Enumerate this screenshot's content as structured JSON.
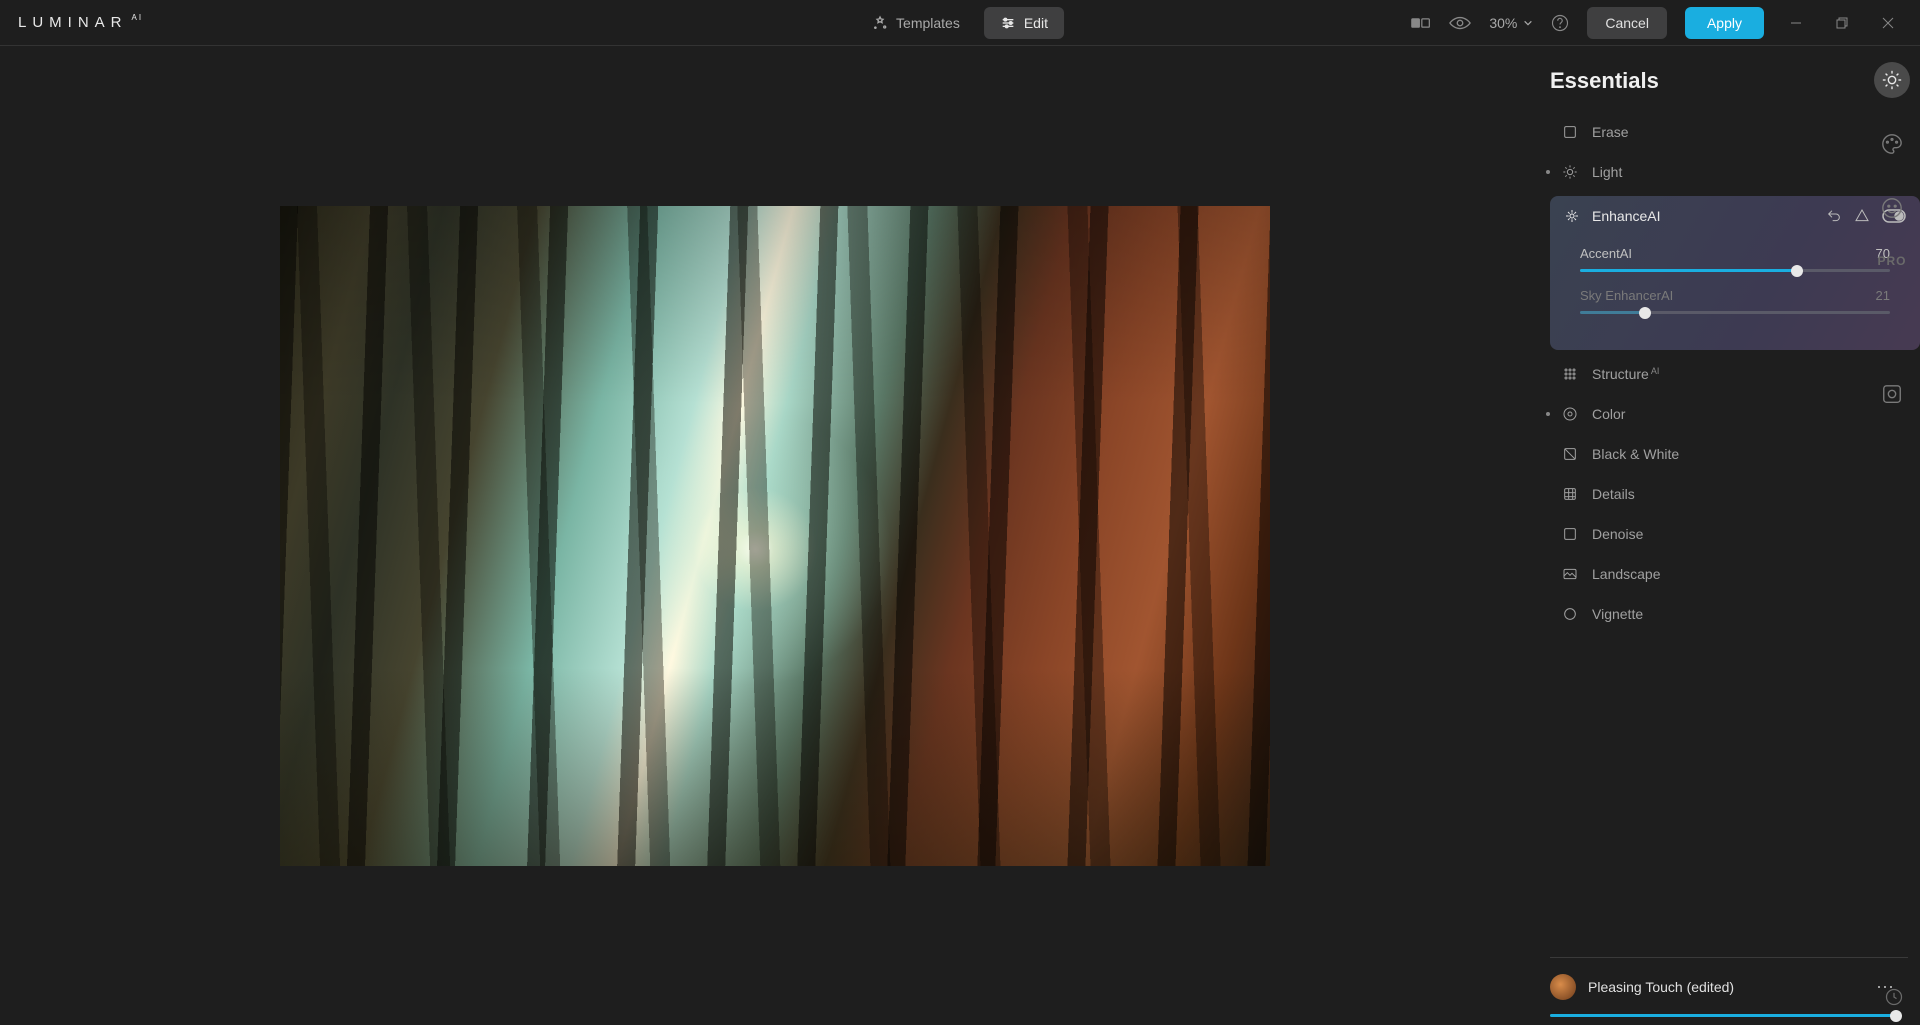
{
  "app": {
    "logo_main": "LUMINAR",
    "logo_sup": "AI"
  },
  "topbar": {
    "templates_label": "Templates",
    "edit_label": "Edit",
    "zoom_value": "30%",
    "cancel_label": "Cancel",
    "apply_label": "Apply"
  },
  "panel": {
    "title": "Essentials",
    "tools": {
      "erase": "Erase",
      "light": "Light",
      "enhance": "Enhance",
      "structure": "Structure",
      "color": "Color",
      "bw": "Black & White",
      "details": "Details",
      "denoise": "Denoise",
      "landscape": "Landscape",
      "vignette": "Vignette",
      "ai_badge": "AI"
    },
    "enhance": {
      "accent_label": "Accent",
      "accent_value": "70",
      "sky_label": "Sky Enhancer",
      "sky_value": "21"
    }
  },
  "rail": {
    "pro_label": "PRO"
  },
  "preset": {
    "name": "Pleasing Touch (edited)"
  },
  "colors": {
    "accent": "#1aaee0"
  }
}
